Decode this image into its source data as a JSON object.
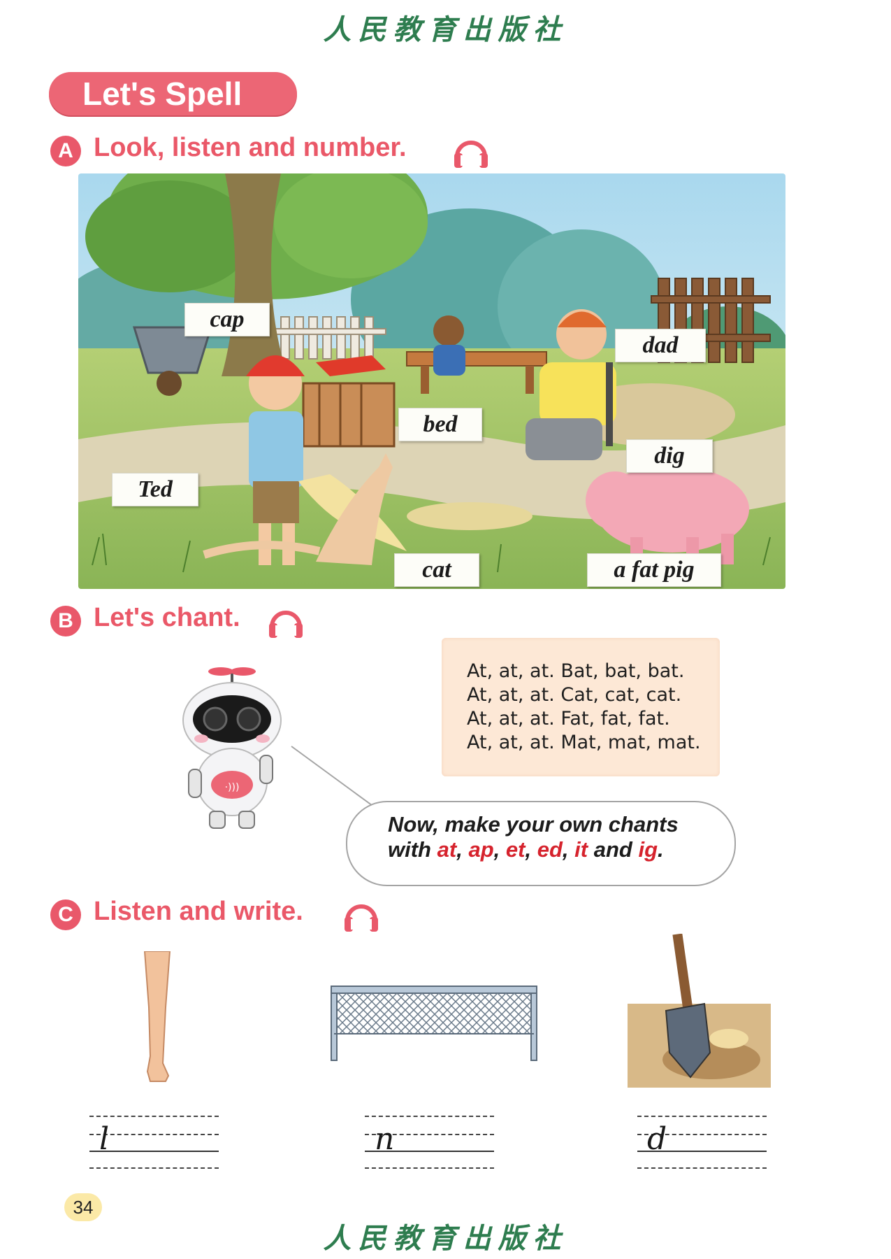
{
  "publisher": "人民教育出版社",
  "banner": "Let's Spell",
  "sections": {
    "a": {
      "badge": "A",
      "title": "Look, listen and number."
    },
    "b": {
      "badge": "B",
      "title": "Let's chant."
    },
    "c": {
      "badge": "C",
      "title": "Listen and write."
    }
  },
  "scene_labels": {
    "cap": "cap",
    "dad": "dad",
    "bed": "bed",
    "dig": "dig",
    "ted": "Ted",
    "cat": "cat",
    "fat_pig": "a fat pig"
  },
  "chant": [
    "At, at, at. Bat, bat, bat.",
    "At, at, at. Cat, cat, cat.",
    "At, at, at. Fat, fat, fat.",
    "At, at, at. Mat, mat, mat."
  ],
  "bubble": {
    "line1": "Now, make your own chants",
    "with": "with",
    "at": "at",
    "ap": "ap",
    "et": "et",
    "ed": "ed",
    "it": "it",
    "and": "and",
    "ig": "ig",
    "comma": ",",
    "period": "."
  },
  "write": {
    "leg": "l",
    "net": "n",
    "dig": "d"
  },
  "page_number": "34",
  "colors": {
    "accent": "#ea5868",
    "publisher": "#2e7d4f",
    "chant_bg": "#fde8d6",
    "highlight_red": "#d6232d"
  }
}
